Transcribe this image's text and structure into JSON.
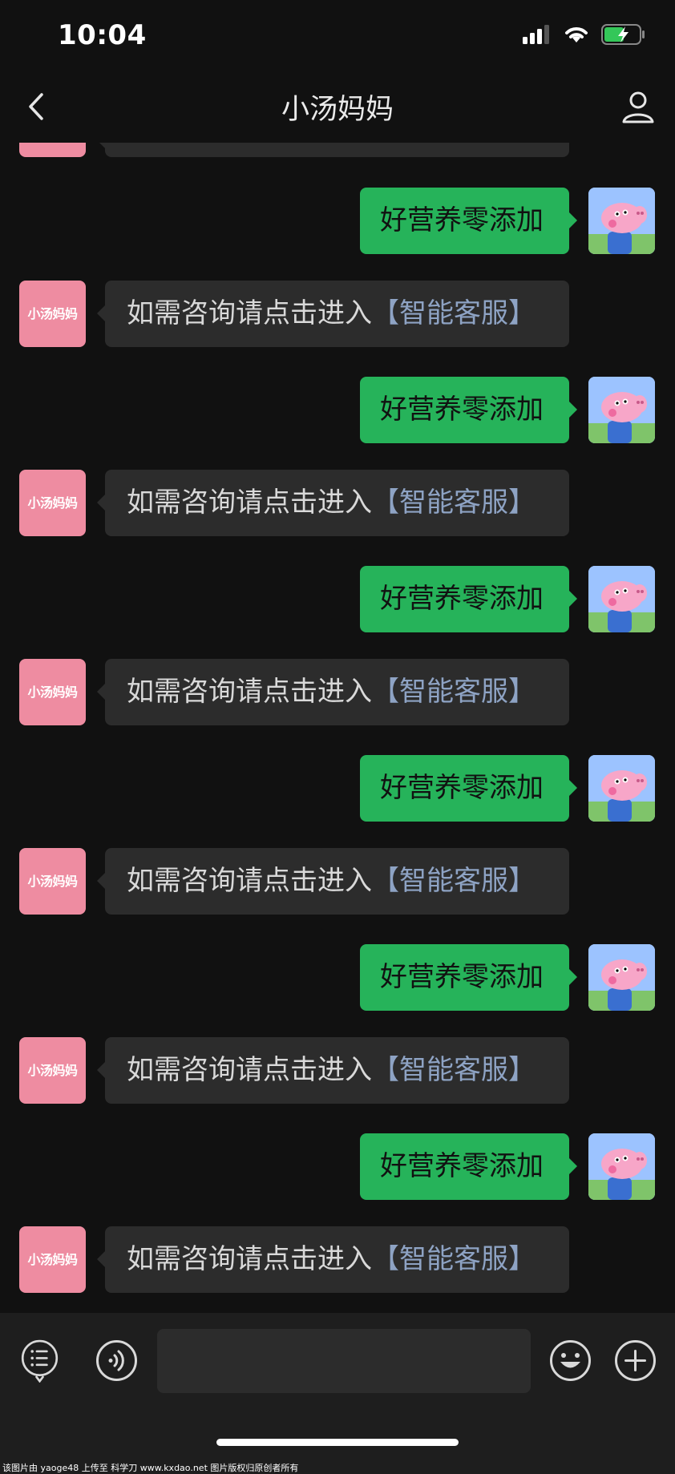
{
  "status_bar": {
    "time": "10:04",
    "icons": [
      "cellular-signal-icon",
      "wifi-icon",
      "battery-charging-icon"
    ]
  },
  "header": {
    "title": "小汤妈妈",
    "back_icon": "chevron-left-icon",
    "profile_icon": "person-icon"
  },
  "contact": {
    "avatar_text": "小汤妈妈",
    "avatar_color": "#ee8ca1"
  },
  "messages": [
    {
      "from": "me",
      "text": "好营养零添加"
    },
    {
      "from": "contact",
      "text": "如需咨询请点击进入",
      "link": "【智能客服】"
    },
    {
      "from": "me",
      "text": "好营养零添加"
    },
    {
      "from": "contact",
      "text": "如需咨询请点击进入",
      "link": "【智能客服】"
    },
    {
      "from": "me",
      "text": "好营养零添加"
    },
    {
      "from": "contact",
      "text": "如需咨询请点击进入",
      "link": "【智能客服】"
    },
    {
      "from": "me",
      "text": "好营养零添加"
    },
    {
      "from": "contact",
      "text": "如需咨询请点击进入",
      "link": "【智能客服】"
    },
    {
      "from": "me",
      "text": "好营养零添加"
    },
    {
      "from": "contact",
      "text": "如需咨询请点击进入",
      "link": "【智能客服】"
    },
    {
      "from": "me",
      "text": "好营养零添加"
    },
    {
      "from": "contact",
      "text": "如需咨询请点击进入",
      "link": "【智能客服】"
    }
  ],
  "input_bar": {
    "text_value": "",
    "icons": [
      "menu-list-icon",
      "voice-icon",
      "emoji-icon",
      "plus-icon"
    ]
  },
  "watermark": "该图片由 yaoge48 上传至 科学刀 www.kxdao.net 图片版权归原创者所有",
  "colors": {
    "background": "#111111",
    "sent_bubble": "#26b35a",
    "received_bubble": "#2c2c2c",
    "link": "#8ea3c4"
  }
}
